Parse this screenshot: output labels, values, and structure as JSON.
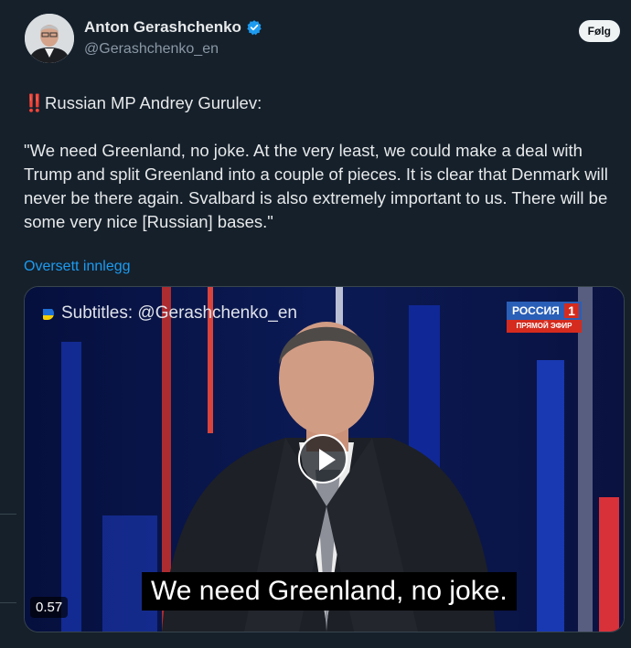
{
  "author": {
    "name": "Anton Gerashchenko",
    "handle": "@Gerashchenko_en",
    "verified": true
  },
  "follow_label": "Følg",
  "post": {
    "prefix": "‼️",
    "headline": "Russian MP Andrey Gurulev:",
    "quote": "\"We need Greenland, no joke. At the very least, we could make a deal with Trump and split Greenland into a couple of pieces. It is clear that Denmark will never be there again. Svalbard is also extremely important to us. There will be some very nice [Russian] bases.\""
  },
  "translate_label": "Oversett innlegg",
  "video": {
    "subtitles_credit": "Subtitles: @Gerashchenko_en",
    "channel_name": "РОССИЯ",
    "channel_number": "1",
    "channel_live": "ПРЯМОЙ ЭФИР",
    "caption": "We need Greenland, no joke.",
    "time": "0.57"
  },
  "colors": {
    "background": "#15202b",
    "link": "#1d9bf0",
    "verified": "#1d9bf0"
  }
}
